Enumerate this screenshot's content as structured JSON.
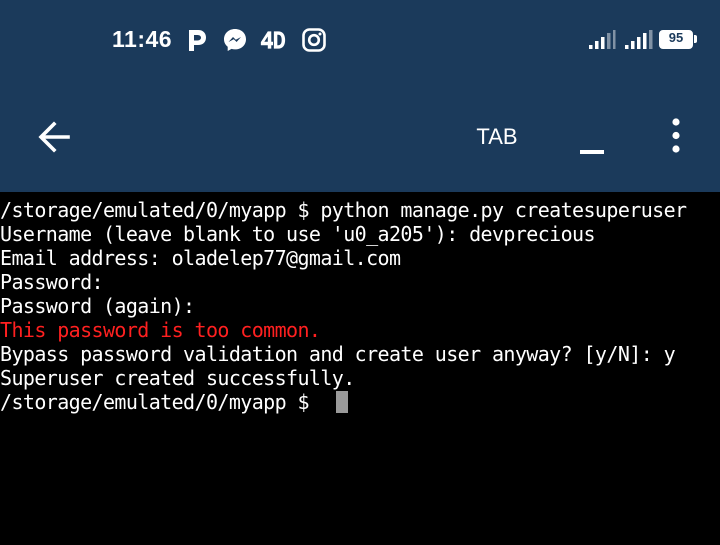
{
  "status_bar": {
    "time": "11:46",
    "battery_level": "95",
    "icons": [
      "parking-icon",
      "messenger-icon",
      "4d-icon",
      "instagram-icon",
      "signal-icon",
      "signal-icon",
      "battery-icon"
    ]
  },
  "toolbar": {
    "back_icon": "arrow-left-icon",
    "tab_label": "TAB",
    "minimize_icon": "underscore-icon",
    "more_icon": "more-vertical-icon"
  },
  "terminal": {
    "lines": [
      "/storage/emulated/0/myapp $ python manage.py createsuperuser",
      "Username (leave blank to use 'u0_a205'): devprecious",
      "Email address: oladelep77@gmail.com",
      "Password:",
      "Password (again):",
      "This password is too common.",
      "Bypass password validation and create user anyway? [y/N]: y",
      "Superuser created successfully.",
      "/storage/emulated/0/myapp $ "
    ],
    "error_color": "#ff2020",
    "text_color": "#ffffff"
  },
  "colors": {
    "header": "#1b3a5b",
    "background": "#000000"
  }
}
